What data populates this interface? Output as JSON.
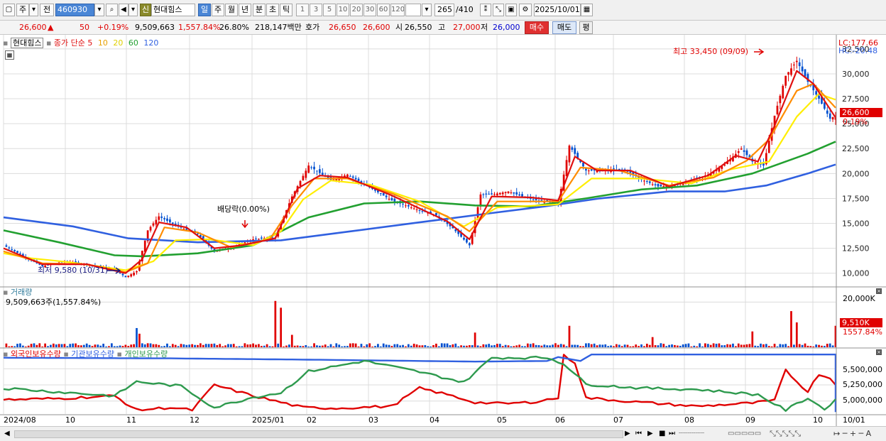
{
  "toolbar": {
    "type_label": "주",
    "prev_label": "전",
    "code": "460930",
    "badge": "신",
    "name": "현대힘스",
    "periods": [
      "일",
      "주",
      "월",
      "년",
      "분",
      "초",
      "틱"
    ],
    "active_period": "일",
    "intervals": [
      "1",
      "3",
      "5",
      "10",
      "20",
      "30",
      "60",
      "120"
    ],
    "count_value": "265",
    "count_total": "/410",
    "date": "2025/10/01"
  },
  "quote": {
    "price": "26,600",
    "change_arrow": "▲",
    "change": "50",
    "change_pct": "+0.19%",
    "volume": "9,509,663",
    "volume_ratio": "1,557.84%",
    "turnover": "26.80%",
    "amount": "218,147백만",
    "ask_label": "호가",
    "ask1": "26,650",
    "ask2": "26,600",
    "open_label": "시",
    "open": "26,550",
    "high_label": "고",
    "high": "27,000",
    "low_label": "저",
    "low": "26,000",
    "buy_label": "매수",
    "sell_label": "매도",
    "avg_label": "평"
  },
  "price_panel": {
    "stock_name": "현대힘스",
    "series_label": "종가 단순",
    "ma_labels": [
      "5",
      "10",
      "20",
      "60",
      "120"
    ],
    "lc_label": "LC:177.66",
    "hc_label": "HC:-20.48",
    "current_price_label": "26,600",
    "current_pct_label": "0.19%",
    "high_annotation": "최고 33,450 (09/09)",
    "low_annotation": "최저 9,580 (10/31)",
    "dividend_annotation": "배당락(0.00%)"
  },
  "volume_panel": {
    "title": "거래량",
    "value_label": "9,509,663주(1,557.84%)",
    "axis_label": "20,000K",
    "current_label": "9,510K",
    "current_pct": "1557.84%"
  },
  "holdings_panel": {
    "legend": [
      "외국인보유수량",
      "기관보유수량",
      "개인보유수량"
    ],
    "ticks": [
      "5,500,000",
      "5,250,000",
      "5,000,000"
    ]
  },
  "x_axis": [
    "2024/08",
    "10",
    "11",
    "12",
    "2025/01",
    "02",
    "03",
    "04",
    "05",
    "06",
    "07",
    "08",
    "09",
    "10",
    "10/01"
  ],
  "colors": {
    "up": "#e00000",
    "down": "#0050d0",
    "ma5": "#e01010",
    "ma10": "#ff8c00",
    "ma20": "#ffee00",
    "ma60": "#22a030",
    "ma120": "#3060e0",
    "foreign": "#e00000",
    "institution": "#3060e0",
    "individual": "#2e9a4e"
  },
  "chart_data": {
    "type": "line",
    "title": "현대힘스 종가 단순",
    "ylim": [
      8700,
      33700
    ],
    "y_ticks": [
      10000,
      12500,
      15000,
      17500,
      20000,
      22500,
      25000,
      27500,
      30000,
      32500
    ],
    "x_months": [
      "2024/08",
      "10",
      "11",
      "12",
      "2025/01",
      "02",
      "03",
      "04",
      "05",
      "06",
      "07",
      "08",
      "09",
      "10"
    ],
    "close_points": [
      [
        0,
        12800
      ],
      [
        8,
        11600
      ],
      [
        14,
        10700
      ],
      [
        22,
        11200
      ],
      [
        32,
        10800
      ],
      [
        40,
        10400
      ],
      [
        44,
        9600
      ],
      [
        48,
        10200
      ],
      [
        52,
        14300
      ],
      [
        56,
        15700
      ],
      [
        62,
        14800
      ],
      [
        70,
        13900
      ],
      [
        76,
        12200
      ],
      [
        82,
        12600
      ],
      [
        90,
        13400
      ],
      [
        98,
        13600
      ],
      [
        104,
        17700
      ],
      [
        110,
        20800
      ],
      [
        118,
        19300
      ],
      [
        124,
        19900
      ],
      [
        132,
        18600
      ],
      [
        140,
        17300
      ],
      [
        148,
        16500
      ],
      [
        156,
        15800
      ],
      [
        162,
        14500
      ],
      [
        168,
        12800
      ],
      [
        172,
        17900
      ],
      [
        176,
        17900
      ],
      [
        182,
        18200
      ],
      [
        188,
        17600
      ],
      [
        194,
        17200
      ],
      [
        200,
        17000
      ],
      [
        204,
        22800
      ],
      [
        210,
        20300
      ],
      [
        216,
        20300
      ],
      [
        224,
        20400
      ],
      [
        230,
        19400
      ],
      [
        236,
        18700
      ],
      [
        242,
        18800
      ],
      [
        248,
        19300
      ],
      [
        254,
        19900
      ],
      [
        260,
        20900
      ],
      [
        266,
        22500
      ],
      [
        270,
        21200
      ],
      [
        274,
        20800
      ],
      [
        278,
        25800
      ],
      [
        282,
        29800
      ],
      [
        286,
        31300
      ],
      [
        290,
        29200
      ],
      [
        294,
        27500
      ],
      [
        298,
        25500
      ],
      [
        300,
        25800
      ]
    ],
    "ma_series": [
      {
        "name": "5",
        "points": [
          [
            0,
            12500
          ],
          [
            14,
            10900
          ],
          [
            30,
            10900
          ],
          [
            44,
            10000
          ],
          [
            50,
            11400
          ],
          [
            56,
            15100
          ],
          [
            66,
            14600
          ],
          [
            76,
            12500
          ],
          [
            86,
            12800
          ],
          [
            98,
            13500
          ],
          [
            106,
            18500
          ],
          [
            114,
            19800
          ],
          [
            124,
            19600
          ],
          [
            140,
            17800
          ],
          [
            160,
            15200
          ],
          [
            168,
            13400
          ],
          [
            176,
            17700
          ],
          [
            190,
            17600
          ],
          [
            200,
            17300
          ],
          [
            206,
            21700
          ],
          [
            214,
            20300
          ],
          [
            226,
            20300
          ],
          [
            240,
            18700
          ],
          [
            254,
            19800
          ],
          [
            264,
            21800
          ],
          [
            272,
            21200
          ],
          [
            278,
            24800
          ],
          [
            286,
            30300
          ],
          [
            292,
            29000
          ],
          [
            300,
            25600
          ]
        ]
      },
      {
        "name": "10",
        "points": [
          [
            0,
            12200
          ],
          [
            14,
            11000
          ],
          [
            30,
            10900
          ],
          [
            44,
            10100
          ],
          [
            52,
            11000
          ],
          [
            58,
            14600
          ],
          [
            70,
            14100
          ],
          [
            82,
            12600
          ],
          [
            96,
            13400
          ],
          [
            104,
            16800
          ],
          [
            112,
            19500
          ],
          [
            124,
            19500
          ],
          [
            140,
            18000
          ],
          [
            160,
            15700
          ],
          [
            168,
            14200
          ],
          [
            178,
            17200
          ],
          [
            200,
            17200
          ],
          [
            208,
            20600
          ],
          [
            222,
            20300
          ],
          [
            240,
            18800
          ],
          [
            256,
            19600
          ],
          [
            268,
            21300
          ],
          [
            276,
            23400
          ],
          [
            286,
            28300
          ],
          [
            292,
            29000
          ],
          [
            300,
            26600
          ]
        ]
      },
      {
        "name": "20",
        "points": [
          [
            0,
            12000
          ],
          [
            10,
            11500
          ],
          [
            24,
            11100
          ],
          [
            44,
            10300
          ],
          [
            54,
            11200
          ],
          [
            62,
            13300
          ],
          [
            74,
            13400
          ],
          [
            90,
            12800
          ],
          [
            100,
            14200
          ],
          [
            108,
            17400
          ],
          [
            118,
            19300
          ],
          [
            132,
            18900
          ],
          [
            150,
            17200
          ],
          [
            166,
            14700
          ],
          [
            178,
            16600
          ],
          [
            200,
            16900
          ],
          [
            212,
            19500
          ],
          [
            230,
            19500
          ],
          [
            248,
            19000
          ],
          [
            262,
            20400
          ],
          [
            276,
            21200
          ],
          [
            286,
            25700
          ],
          [
            294,
            28000
          ],
          [
            300,
            27400
          ]
        ]
      },
      {
        "name": "60",
        "points": [
          [
            0,
            14300
          ],
          [
            20,
            13100
          ],
          [
            40,
            11800
          ],
          [
            50,
            11700
          ],
          [
            70,
            12000
          ],
          [
            90,
            12800
          ],
          [
            110,
            15600
          ],
          [
            130,
            17000
          ],
          [
            150,
            17200
          ],
          [
            170,
            16800
          ],
          [
            190,
            16700
          ],
          [
            210,
            17500
          ],
          [
            230,
            18400
          ],
          [
            250,
            18800
          ],
          [
            270,
            20000
          ],
          [
            290,
            22000
          ],
          [
            300,
            23200
          ]
        ]
      },
      {
        "name": "120",
        "points": [
          [
            0,
            15600
          ],
          [
            25,
            14700
          ],
          [
            45,
            13500
          ],
          [
            70,
            13100
          ],
          [
            100,
            13300
          ],
          [
            125,
            14200
          ],
          [
            150,
            15100
          ],
          [
            175,
            16000
          ],
          [
            195,
            16700
          ],
          [
            215,
            17500
          ],
          [
            240,
            18200
          ],
          [
            260,
            18200
          ],
          [
            275,
            18800
          ],
          [
            290,
            20000
          ],
          [
            300,
            20900
          ]
        ]
      }
    ],
    "volume": {
      "ylim": [
        0,
        22000
      ],
      "spikes": [
        [
          48,
          8500,
          "down"
        ],
        [
          49,
          6000,
          "up"
        ],
        [
          98,
          20500,
          "up"
        ],
        [
          100,
          17500,
          "up"
        ],
        [
          104,
          5500,
          "up"
        ],
        [
          170,
          6500,
          "up"
        ],
        [
          204,
          9500,
          "up"
        ],
        [
          234,
          4500,
          "up"
        ],
        [
          270,
          7000,
          "up"
        ],
        [
          284,
          16000,
          "up"
        ],
        [
          286,
          11000,
          "up"
        ],
        [
          300,
          9510,
          "up"
        ]
      ]
    },
    "holdings": {
      "ylim": [
        4800000,
        5700000
      ],
      "series": [
        {
          "name": "외국인보유수량",
          "points": [
            [
              0,
              5020000
            ],
            [
              20,
              5040000
            ],
            [
              40,
              5080000
            ],
            [
              48,
              4860000
            ],
            [
              60,
              4900000
            ],
            [
              68,
              4860000
            ],
            [
              76,
              5250000
            ],
            [
              90,
              5080000
            ],
            [
              100,
              4980000
            ],
            [
              108,
              4900000
            ],
            [
              120,
              4890000
            ],
            [
              140,
              4920000
            ],
            [
              150,
              5200000
            ],
            [
              160,
              5100000
            ],
            [
              170,
              4980000
            ],
            [
              180,
              4960000
            ],
            [
              190,
              4980000
            ],
            [
              200,
              5050000
            ],
            [
              202,
              5700000
            ],
            [
              206,
              5600000
            ],
            [
              210,
              5050000
            ],
            [
              230,
              4980000
            ],
            [
              250,
              4920000
            ],
            [
              270,
              4970000
            ],
            [
              278,
              5010000
            ],
            [
              282,
              5480000
            ],
            [
              286,
              5300000
            ],
            [
              290,
              5150000
            ],
            [
              294,
              5420000
            ],
            [
              298,
              5350000
            ],
            [
              300,
              5250000
            ]
          ]
        },
        {
          "name": "기관보유수량",
          "points": [
            [
              0,
              5670000
            ],
            [
              60,
              5660000
            ],
            [
              110,
              5640000
            ],
            [
              170,
              5610000
            ],
            [
              196,
              5620000
            ],
            [
              200,
              5680000
            ],
            [
              208,
              5620000
            ],
            [
              212,
              5720000
            ],
            [
              260,
              5720000
            ],
            [
              300,
              5720000
            ],
            [
              300,
              4830000
            ]
          ]
        },
        {
          "name": "개인보유수량",
          "points": [
            [
              0,
              5200000
            ],
            [
              40,
              5080000
            ],
            [
              48,
              5300000
            ],
            [
              64,
              5230000
            ],
            [
              76,
              4900000
            ],
            [
              90,
              5060000
            ],
            [
              100,
              5130000
            ],
            [
              110,
              5460000
            ],
            [
              130,
              5620000
            ],
            [
              150,
              5450000
            ],
            [
              166,
              5290000
            ],
            [
              176,
              5670000
            ],
            [
              196,
              5670000
            ],
            [
              202,
              5580000
            ],
            [
              210,
              5260000
            ],
            [
              230,
              5200000
            ],
            [
              250,
              5180000
            ],
            [
              272,
              5100000
            ],
            [
              282,
              4860000
            ],
            [
              290,
              5050000
            ],
            [
              296,
              4870000
            ],
            [
              300,
              5030000
            ]
          ]
        }
      ]
    }
  }
}
